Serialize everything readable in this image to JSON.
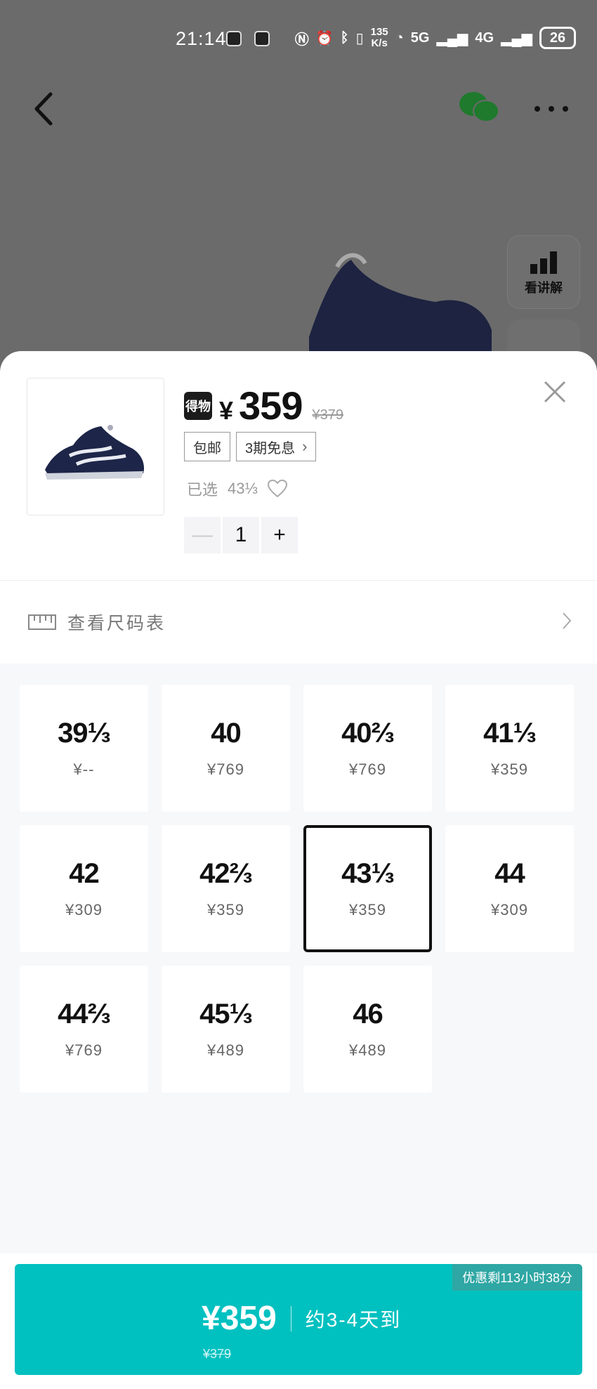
{
  "status_bar": {
    "time": "21:14",
    "speed_top": "135",
    "speed_bottom": "K/s",
    "net1": "5G",
    "net2": "4G",
    "battery": "26"
  },
  "background": {
    "side_button_label": "看讲解"
  },
  "product": {
    "logo_text": "得物",
    "currency": "¥",
    "price": "359",
    "original_price": "¥379",
    "tags": [
      {
        "label": "包邮"
      },
      {
        "label": "3期免息"
      }
    ],
    "selected_label": "已选",
    "selected_size": "43⅓",
    "quantity": "1",
    "minus": "—",
    "plus": "+"
  },
  "size_chart": {
    "label": "查看尺码表"
  },
  "sizes": [
    {
      "size": "39⅓",
      "price": "¥--"
    },
    {
      "size": "40",
      "price": "¥769"
    },
    {
      "size": "40⅔",
      "price": "¥769"
    },
    {
      "size": "41⅓",
      "price": "¥359"
    },
    {
      "size": "42",
      "price": "¥309"
    },
    {
      "size": "42⅔",
      "price": "¥359"
    },
    {
      "size": "43⅓",
      "price": "¥359",
      "selected": true
    },
    {
      "size": "44",
      "price": "¥309"
    },
    {
      "size": "44⅔",
      "price": "¥769"
    },
    {
      "size": "45⅓",
      "price": "¥489"
    },
    {
      "size": "46",
      "price": "¥489"
    }
  ],
  "buy_bar": {
    "promo": "优惠剩113小时38分",
    "price": "¥359",
    "eta": "约3-4天到",
    "original_price": "¥379"
  },
  "colors": {
    "accent": "#00c1c0",
    "overlay": "#6b6b6b"
  }
}
